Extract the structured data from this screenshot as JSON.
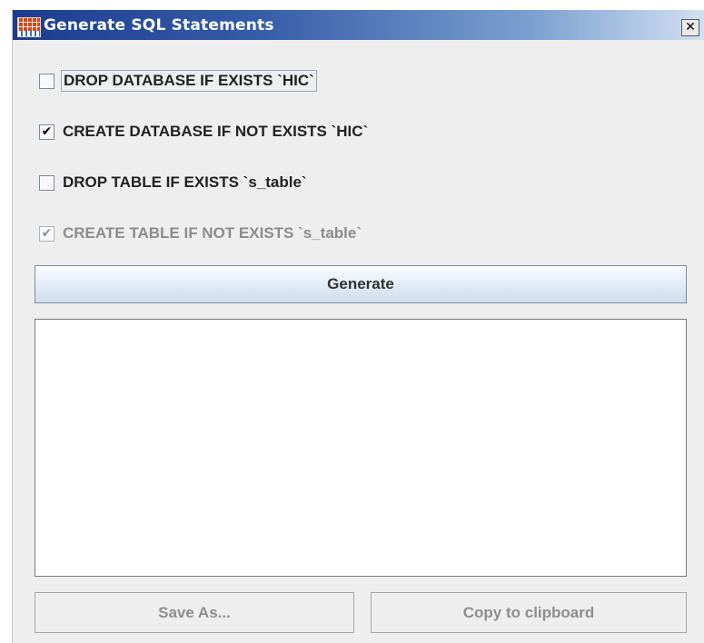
{
  "window": {
    "title": "Generate SQL Statements",
    "close_glyph": "✕",
    "app_icon": "table-grid-icon"
  },
  "options": [
    {
      "label": "DROP DATABASE IF EXISTS `HIC`",
      "checked": false,
      "enabled": true,
      "focused": true
    },
    {
      "label": "CREATE DATABASE IF NOT EXISTS `HIC`",
      "checked": true,
      "enabled": true,
      "focused": false
    },
    {
      "label": "DROP TABLE IF EXISTS `s_table`",
      "checked": false,
      "enabled": true,
      "focused": false
    },
    {
      "label": "CREATE TABLE IF NOT EXISTS `s_table`",
      "checked": true,
      "enabled": false,
      "focused": false
    }
  ],
  "check_glyph": "✔",
  "buttons": {
    "generate": "Generate",
    "save_as": "Save As...",
    "copy": "Copy to clipboard"
  },
  "output": {
    "value": ""
  },
  "colors": {
    "title_bar_start": "#1b3c90",
    "title_bar_end": "#d2e0f2",
    "window_bg": "#eeeeee",
    "disabled_text": "#8e8e8e"
  }
}
